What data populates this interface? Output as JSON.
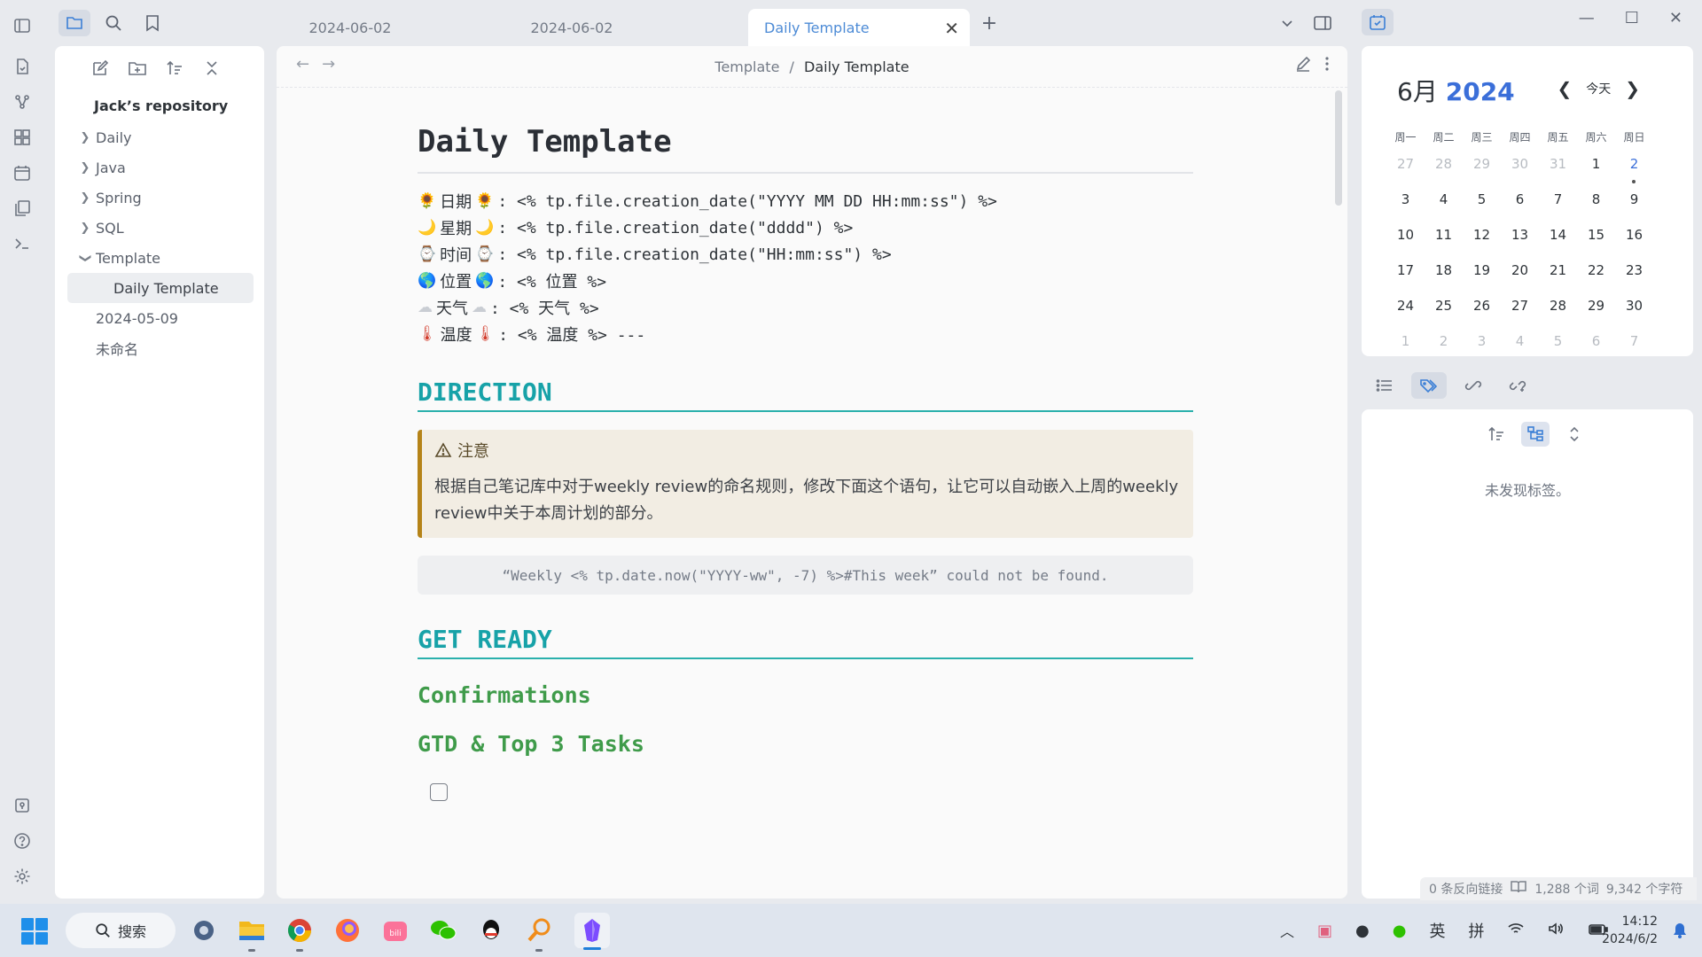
{
  "tabs": [
    {
      "label": "2024-06-02"
    },
    {
      "label": "2024-06-02"
    },
    {
      "label": "Daily Template",
      "active": true
    }
  ],
  "sidebar": {
    "vault_name": "Jack’s repository",
    "items": [
      {
        "label": "Daily",
        "type": "folder"
      },
      {
        "label": "Java",
        "type": "folder"
      },
      {
        "label": "Spring",
        "type": "folder"
      },
      {
        "label": "SQL",
        "type": "folder"
      },
      {
        "label": "Template",
        "type": "folder",
        "expanded": true
      },
      {
        "label": "Daily Template",
        "type": "file",
        "selected": true
      },
      {
        "label": "2024-05-09",
        "type": "file"
      },
      {
        "label": "未命名",
        "type": "file"
      }
    ]
  },
  "editor": {
    "breadcrumb_parent": "Template",
    "breadcrumb_sep": "/",
    "breadcrumb_current": "Daily Template",
    "title": "Daily Template",
    "meta": [
      {
        "icon": "🌻",
        "label": "日期",
        "value": ": <% tp.file.creation_date(\"YYYY MM DD HH:mm:ss\") %>"
      },
      {
        "icon": "🌙",
        "label": "星期",
        "value": ": <% tp.file.creation_date(\"dddd\") %>"
      },
      {
        "icon": "⌚",
        "label": "时间",
        "value": ": <% tp.file.creation_date(\"HH:mm:ss\") %>"
      },
      {
        "icon": "🌎",
        "label": "位置",
        "value": ": <% 位置 %>"
      },
      {
        "icon": "☁",
        "label": "天气",
        "value": ": <% 天气 %>"
      },
      {
        "icon": "🌡",
        "label": "温度",
        "value": ": <% 温度 %> ---"
      }
    ],
    "section1": "DIRECTION",
    "callout_title": "注意",
    "callout_body": "根据自己笔记库中对于weekly review的命名规则，修改下面这个语句，让它可以自动嵌入上周的weekly review中关于本周计划的部分。",
    "embed_error": "“Weekly <% tp.date.now(\"YYYY-ww\", -7) %>#This week” could not be found.",
    "section2": "GET READY",
    "h3a": "Confirmations",
    "h3b": "GTD & Top 3 Tasks"
  },
  "calendar": {
    "month": "6月",
    "year": "2024",
    "today_label": "今天",
    "weekdays": [
      "周一",
      "周二",
      "周三",
      "周四",
      "周五",
      "周六",
      "周日"
    ],
    "days": [
      [
        "27",
        "28",
        "29",
        "30",
        "31",
        "1",
        "2"
      ],
      [
        "3",
        "4",
        "5",
        "6",
        "7",
        "8",
        "9"
      ],
      [
        "10",
        "11",
        "12",
        "13",
        "14",
        "15",
        "16"
      ],
      [
        "17",
        "18",
        "19",
        "20",
        "21",
        "22",
        "23"
      ],
      [
        "24",
        "25",
        "26",
        "27",
        "28",
        "29",
        "30"
      ],
      [
        "1",
        "2",
        "3",
        "4",
        "5",
        "6",
        "7"
      ]
    ]
  },
  "tags_panel": {
    "empty_text": "未发现标签。"
  },
  "statusbar": {
    "backlinks": "0 条反向链接",
    "words": "1,288 个词",
    "chars": "9,342 个字符"
  },
  "taskbar": {
    "search_label": "搜索",
    "ime_lang": "英",
    "ime_mode": "拼",
    "time": "14:12",
    "date": "2024/6/2"
  },
  "colors": {
    "accent": "#3b7fd6",
    "heading_teal": "#17a2a8",
    "heading_green": "#3f9b4a",
    "callout_border": "#b58318"
  }
}
